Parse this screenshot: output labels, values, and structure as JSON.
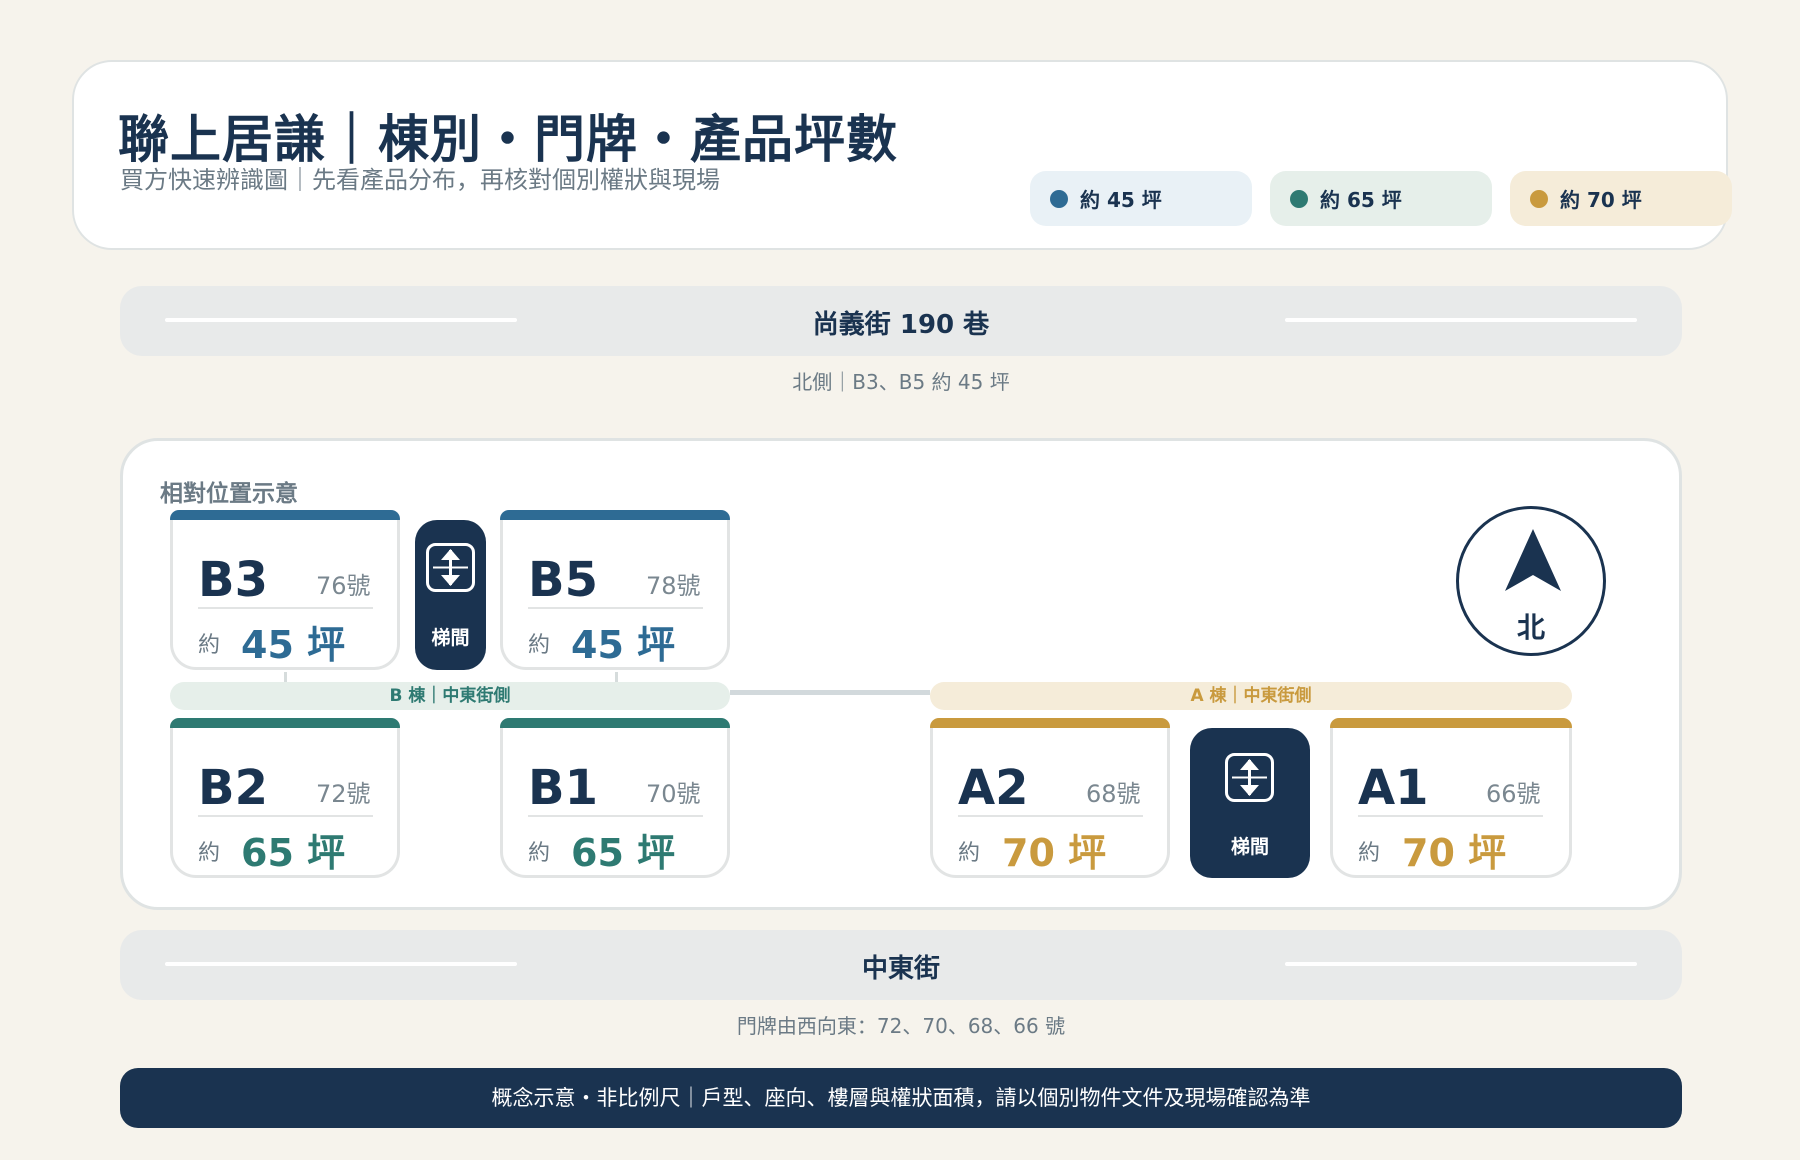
{
  "header": {
    "title": "聯上居謙｜棟別・門牌・產品坪數",
    "subtitle": "買方快速辨識圖｜先看產品分布，再核對個別權狀與現場"
  },
  "legend": [
    {
      "label": "約 45 坪",
      "color": "#2e6b94",
      "bg": "#e9f1f6"
    },
    {
      "label": "約 65 坪",
      "color": "#2e7a72",
      "bg": "#e6efea"
    },
    {
      "label": "約 70 坪",
      "color": "#c99a3e",
      "bg": "#f5ecd9"
    }
  ],
  "north_street": {
    "name": "尚義街 190 巷",
    "note": "北側｜B3、B5 約 45 坪"
  },
  "south_street": {
    "name": "中東街",
    "note": "門牌由西向東：72、70、68、66 號"
  },
  "map": {
    "caption": "相對位置示意",
    "stair_label": "梯間",
    "band_b": "B 棟｜中東街側",
    "band_a": "A 棟｜中東街側",
    "north_label": "北",
    "units": {
      "B3": {
        "code": "B3",
        "number": "76號",
        "approx": "約",
        "size": "45 坪"
      },
      "B5": {
        "code": "B5",
        "number": "78號",
        "approx": "約",
        "size": "45 坪"
      },
      "B2": {
        "code": "B2",
        "number": "72號",
        "approx": "約",
        "size": "65 坪"
      },
      "B1": {
        "code": "B1",
        "number": "70號",
        "approx": "約",
        "size": "65 坪"
      },
      "A2": {
        "code": "A2",
        "number": "68號",
        "approx": "約",
        "size": "70 坪"
      },
      "A1": {
        "code": "A1",
        "number": "66號",
        "approx": "約",
        "size": "70 坪"
      }
    }
  },
  "footer": "概念示意・非比例尺｜戶型、座向、樓層與權狀面積，請以個別物件文件及現場確認為準",
  "colors": {
    "navy": "#1a3350",
    "blue": "#2e6b94",
    "teal": "#2e7a72",
    "gold": "#c99a3e",
    "background": "#f6f3ec"
  }
}
